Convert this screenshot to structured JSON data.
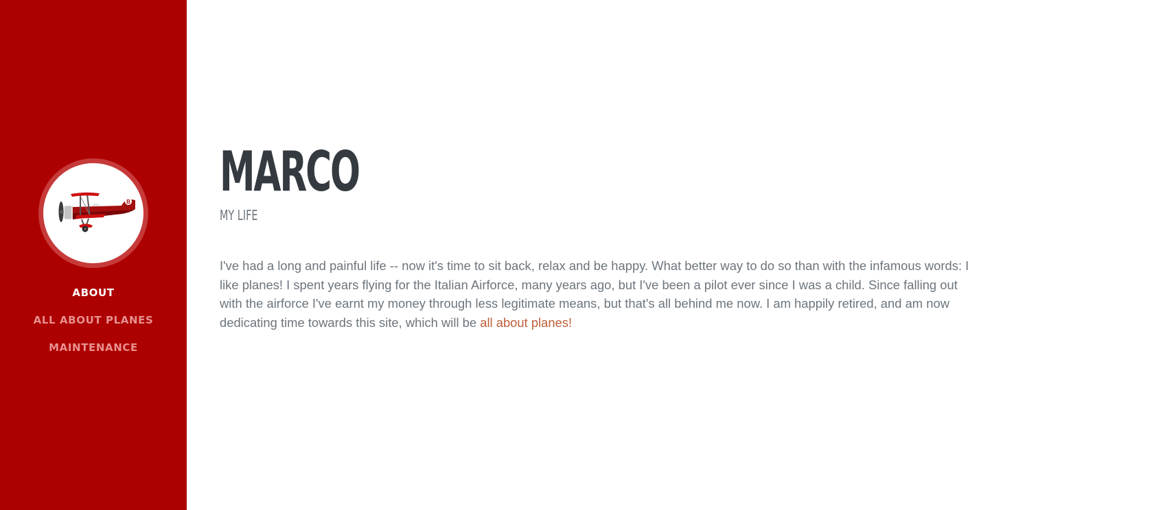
{
  "sidebar": {
    "background_color": "#ad0000",
    "avatar_icon": "biplane-icon",
    "avatar_badge": "B",
    "nav": [
      {
        "label": "About",
        "active": true
      },
      {
        "label": "All About Planes",
        "active": false
      },
      {
        "label": "Maintenance",
        "active": false
      }
    ]
  },
  "main": {
    "title": "Marco",
    "subtitle": "My Life",
    "bio_text": "I've had a long and painful life -- now it's time to sit back, relax and be happy. What better way to do so than with the infamous words: I like planes! I spent years flying for the Italian Airforce, many years ago, but I've been a pilot ever since I was a child. Since falling out with the airforce I've earnt my money through less legitimate means, but that's all behind me now. I am happily retired, and am now dedicating time towards this site, which will be ",
    "bio_link": "all about planes!",
    "link_color": "#bd5d38"
  }
}
